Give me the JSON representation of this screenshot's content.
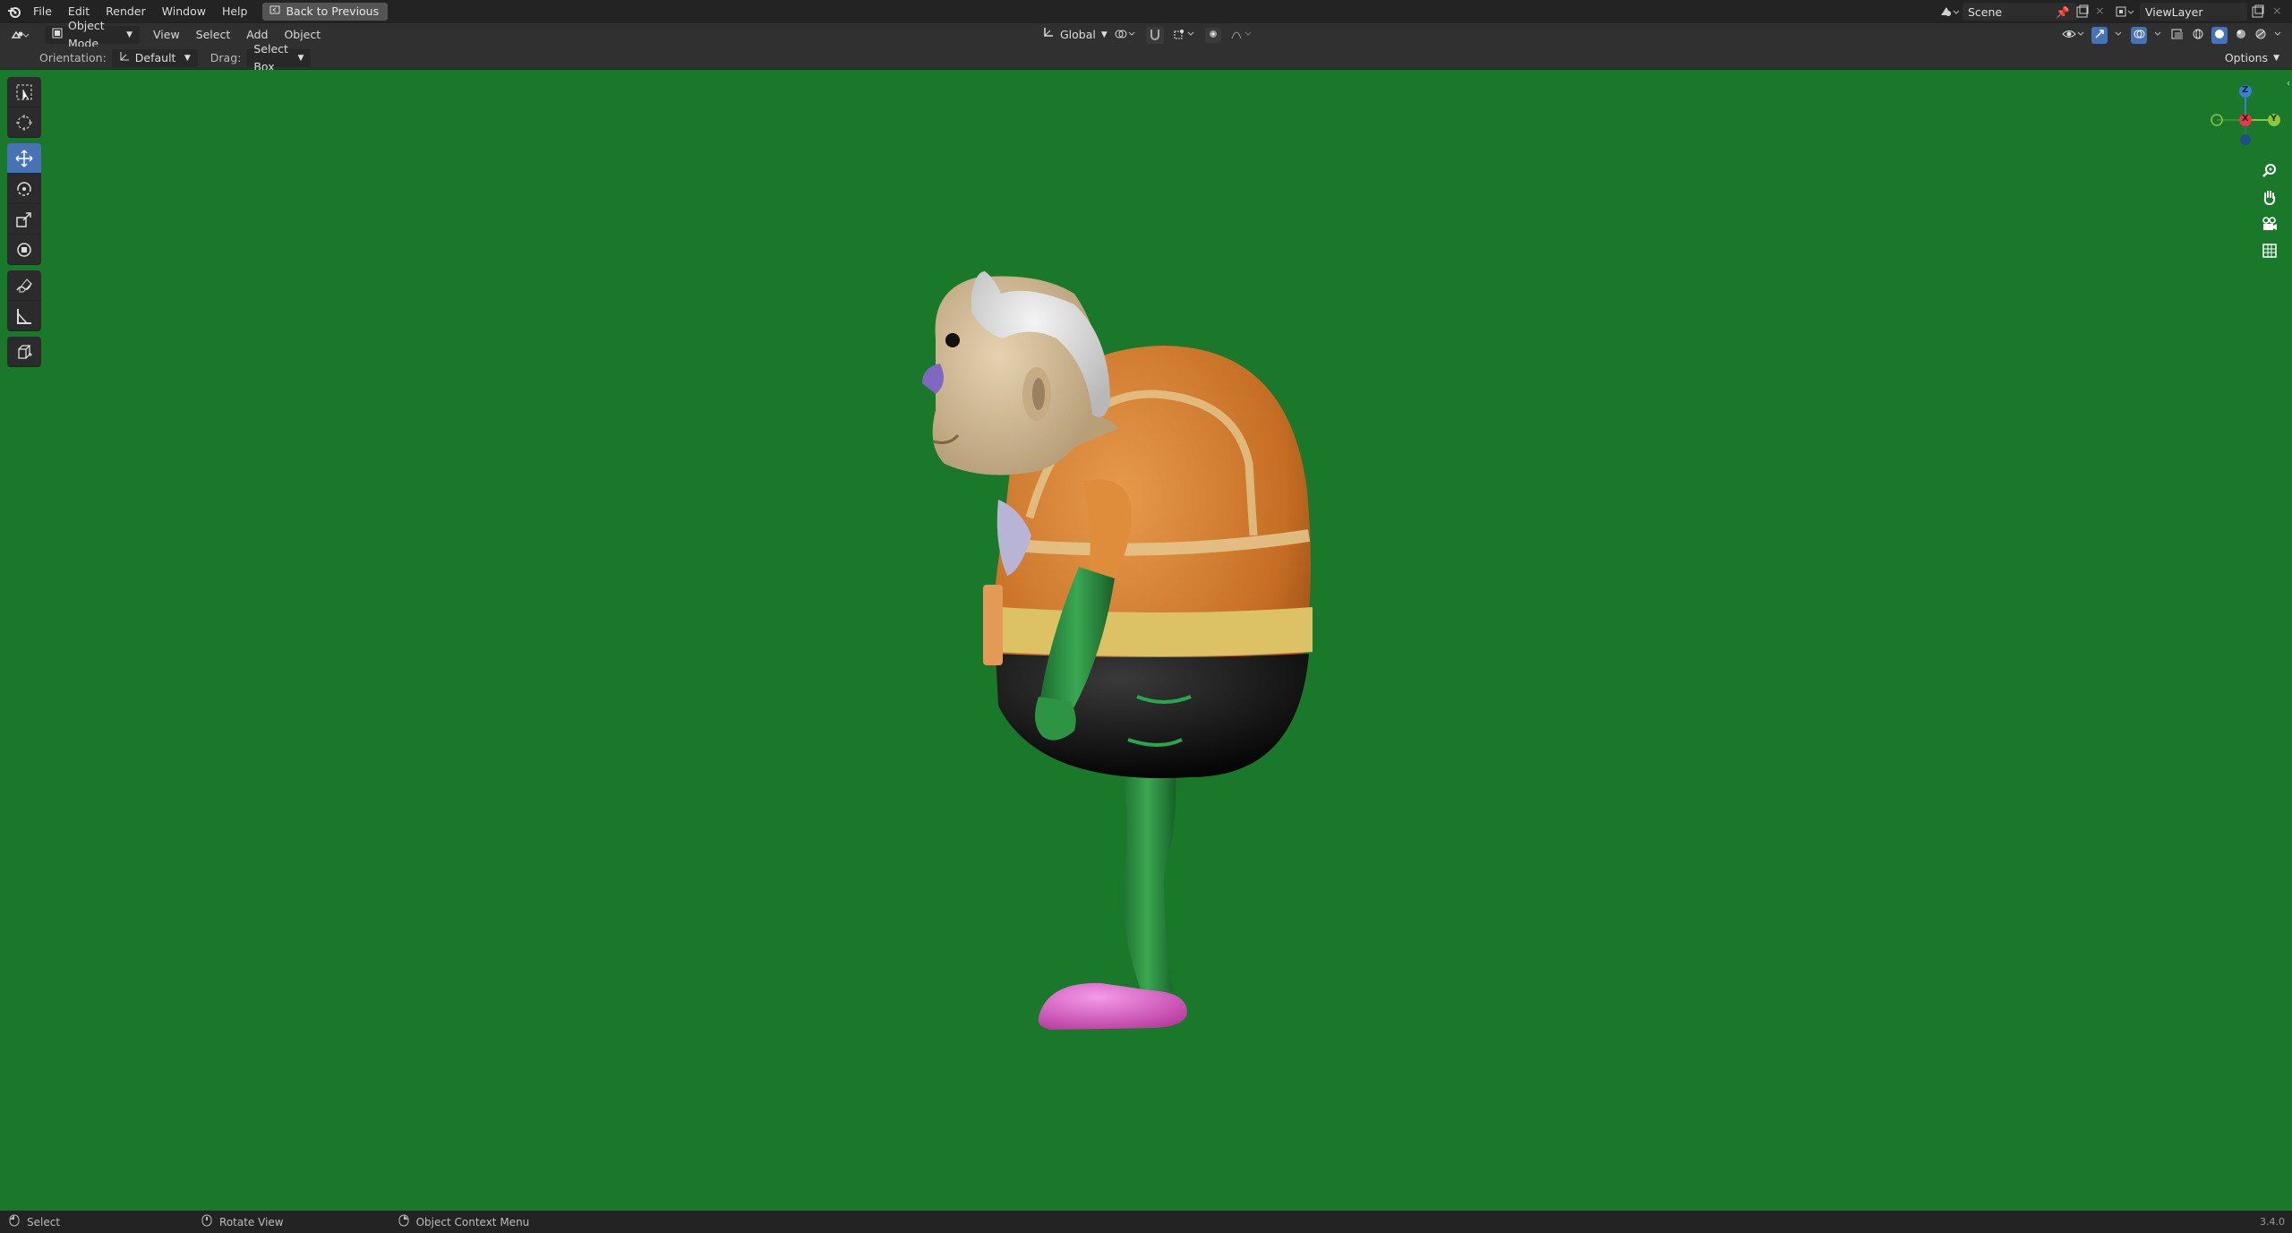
{
  "topbar": {
    "menus": [
      "File",
      "Edit",
      "Render",
      "Window",
      "Help"
    ],
    "back_button": "Back to Previous",
    "scene": "Scene",
    "view_layer": "ViewLayer"
  },
  "header": {
    "mode": "Object Mode",
    "menus": [
      "View",
      "Select",
      "Add",
      "Object"
    ],
    "transform_orientation": "Global"
  },
  "tool_settings": {
    "orientation_label": "Orientation:",
    "orientation_value": "Default",
    "drag_label": "Drag:",
    "drag_value": "Select Box",
    "options": "Options"
  },
  "gizmo": {
    "z": "Z",
    "x": "X",
    "y": "Y"
  },
  "viewport": {
    "background": "#1a782b"
  },
  "statusbar": {
    "select": "Select",
    "rotate": "Rotate View",
    "context": "Object Context Menu",
    "version": "3.4.0"
  },
  "colors": {
    "accent": "#4772b3",
    "x_axis": "#e8384f",
    "y_axis": "#8bc63f",
    "z_axis": "#3a7fd5"
  }
}
